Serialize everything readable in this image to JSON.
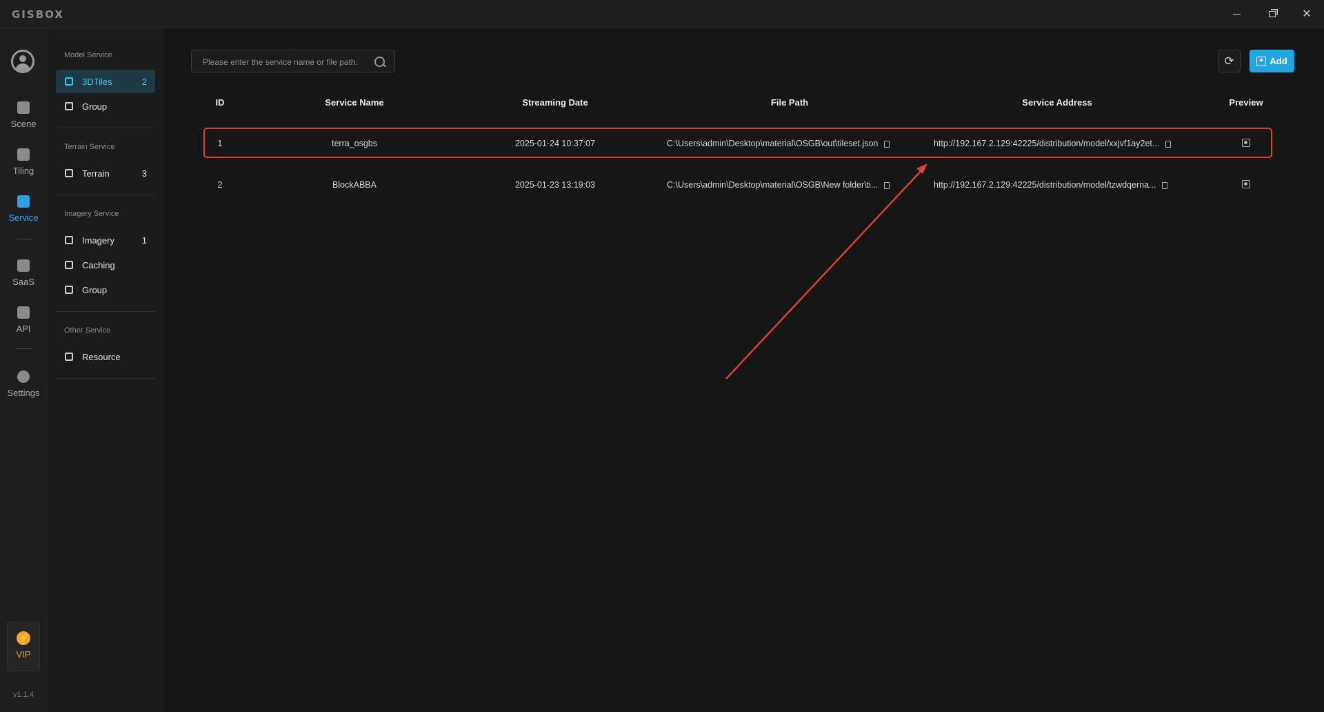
{
  "app": {
    "logo": "GISBOX",
    "window_controls": [
      "minimize",
      "restore",
      "close"
    ]
  },
  "rail": {
    "items": [
      {
        "label": "Scene",
        "icon": "home-icon"
      },
      {
        "label": "Tiling",
        "icon": "tiling-icon"
      },
      {
        "label": "Service",
        "icon": "service-icon",
        "active": true
      },
      {
        "label": "SaaS",
        "icon": "lock-icon"
      },
      {
        "label": "API",
        "icon": "link-icon"
      },
      {
        "label": "Settings",
        "icon": "gear-icon"
      }
    ],
    "vip_label": "VIP",
    "version": "v1.1.4"
  },
  "subnav": {
    "sections": [
      {
        "title": "Model Service",
        "items": [
          {
            "label": "3DTiles",
            "count": "2",
            "active": true
          },
          {
            "label": "Group",
            "count": ""
          }
        ]
      },
      {
        "title": "Terrain Service",
        "items": [
          {
            "label": "Terrain",
            "count": "3"
          }
        ]
      },
      {
        "title": "Imagery Service",
        "items": [
          {
            "label": "Imagery",
            "count": "1"
          },
          {
            "label": "Caching",
            "count": ""
          },
          {
            "label": "Group",
            "count": ""
          }
        ]
      },
      {
        "title": "Other Service",
        "items": [
          {
            "label": "Resource",
            "count": ""
          }
        ]
      }
    ]
  },
  "toolbar": {
    "search_placeholder": "Please enter the service name or file path.",
    "add_label": "Add"
  },
  "table": {
    "headers": {
      "id": "ID",
      "name": "Service Name",
      "date": "Streaming Date",
      "path": "File Path",
      "address": "Service Address",
      "preview": "Preview"
    },
    "rows": [
      {
        "id": "1",
        "name": "terra_osgbs",
        "date": "2025-01-24 10:37:07",
        "path": "C:\\Users\\admin\\Desktop\\material\\OSGB\\out\\tileset.json",
        "address": "http://192.167.2.129:42225/distribution/model/xxjvf1ay2et..."
      },
      {
        "id": "2",
        "name": "BlockABBA",
        "date": "2025-01-23 13:19:03",
        "path": "C:\\Users\\admin\\Desktop\\material\\OSGB\\New folder\\ti...",
        "address": "http://192.167.2.129:42225/distribution/model/tzwdqerna..."
      }
    ]
  },
  "annotation": {
    "highlight_color": "#e04030"
  }
}
